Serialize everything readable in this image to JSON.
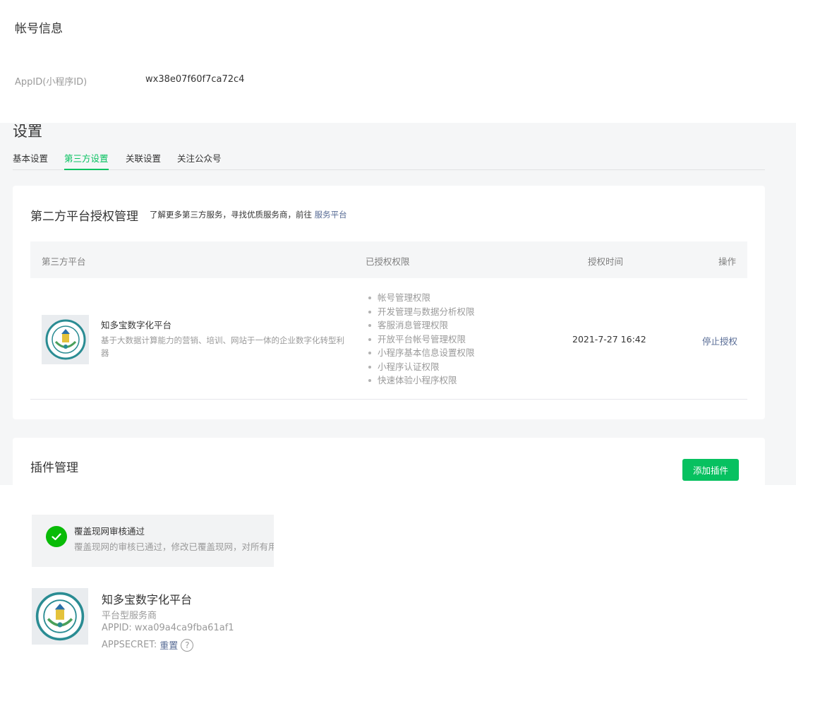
{
  "account": {
    "title": "帐号信息",
    "appid_label": "AppID(小程序ID)",
    "appid_value": "wx38e07f60f7ca72c4"
  },
  "settings": {
    "title": "设置",
    "tabs": [
      {
        "label": "基本设置",
        "active": false
      },
      {
        "label": "第三方设置",
        "active": true
      },
      {
        "label": "关联设置",
        "active": false
      },
      {
        "label": "关注公众号",
        "active": false
      }
    ]
  },
  "third_party": {
    "title": "第二方平台授权管理",
    "hint_prefix": "了解更多第三方服务，寻找优质服务商，前往 ",
    "hint_link": "服务平台",
    "columns": [
      "第三方平台",
      "已授权权限",
      "授权时间",
      "操作"
    ],
    "rows": [
      {
        "name": "知多宝数字化平台",
        "description": "基于大数据计算能力的营销、培训、网站于一体的企业数字化转型利器",
        "permissions": [
          "帐号管理权限",
          "开发管理与数据分析权限",
          "客服消息管理权限",
          "开放平台帐号管理权限",
          "小程序基本信息设置权限",
          "小程序认证权限",
          "快速体验小程序权限"
        ],
        "time": "2021-7-27 16:42",
        "action": "停止授权"
      }
    ]
  },
  "plugins": {
    "title": "插件管理",
    "add_button": "添加插件"
  },
  "notice": {
    "title": "覆盖现网审核通过",
    "description": "覆盖现网的审核已通过，修改已覆盖现网，对所有用户生效"
  },
  "provider": {
    "name": "知多宝数字化平台",
    "type": "平台型服务商",
    "appid": "APPID: wxa09a4ca9fba61af1",
    "secret_label": "APPSECRET:",
    "secret_link": "重置",
    "help_glyph": "?"
  },
  "colors": {
    "accent_green": "#07c160",
    "link_blue": "#576b95",
    "success_green": "#09bb07"
  }
}
